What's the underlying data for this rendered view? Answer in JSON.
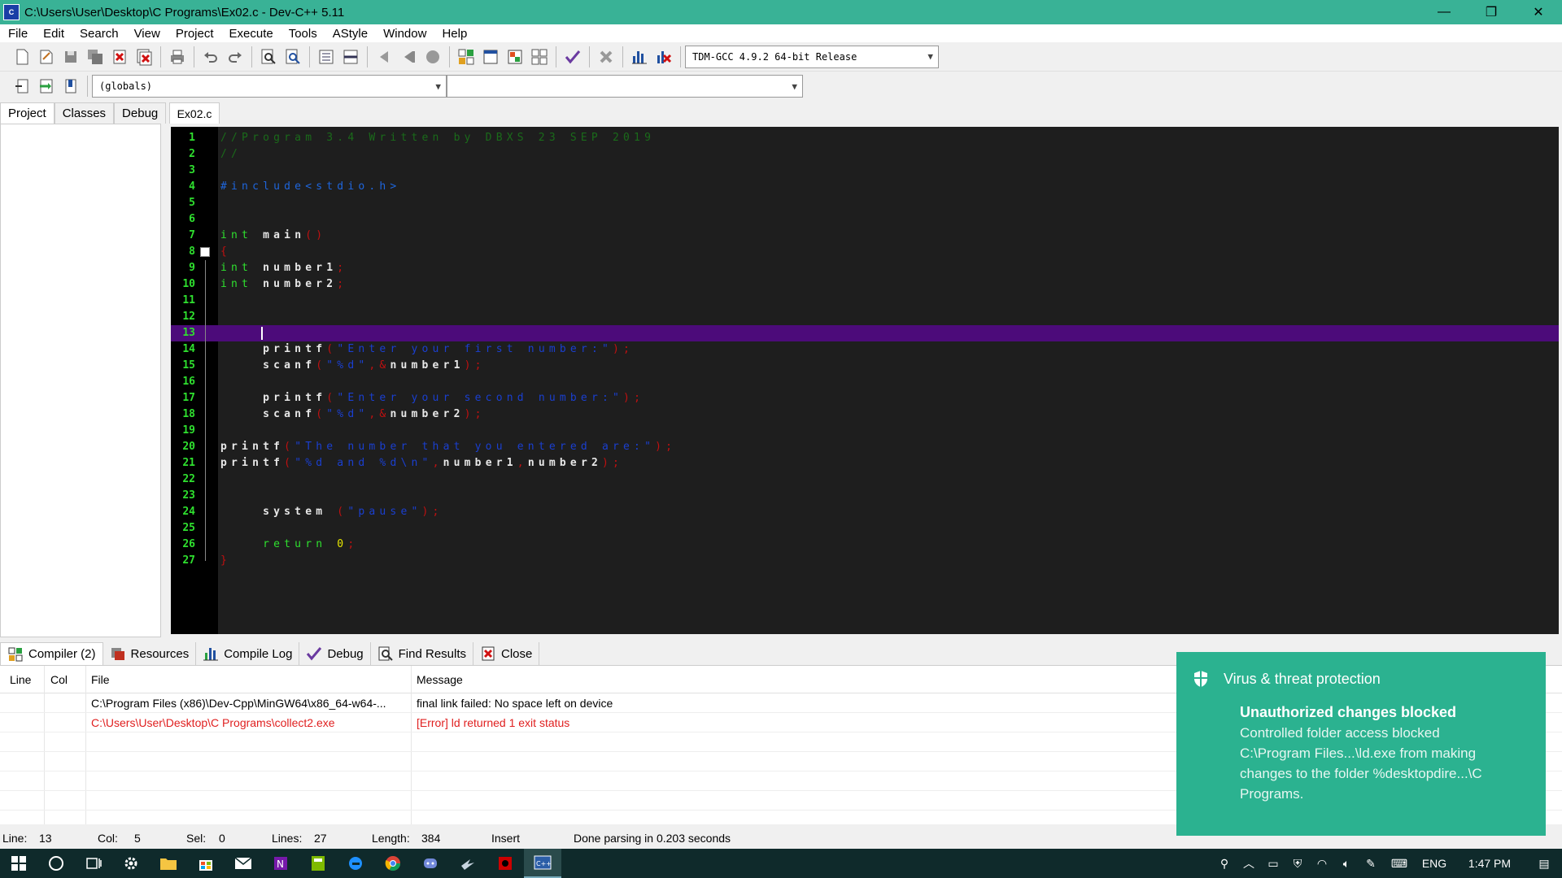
{
  "window": {
    "title": "C:\\Users\\User\\Desktop\\C Programs\\Ex02.c - Dev-C++ 5.11",
    "controls": [
      "—",
      "❐",
      "✕"
    ]
  },
  "menu": [
    "File",
    "Edit",
    "Search",
    "View",
    "Project",
    "Execute",
    "Tools",
    "AStyle",
    "Window",
    "Help"
  ],
  "toolbar": {
    "compiler": "TDM-GCC 4.9.2 64-bit Release",
    "scope": "(globals)",
    "member": ""
  },
  "left_tabs": [
    "Project",
    "Classes",
    "Debug"
  ],
  "editor": {
    "file_tab": "Ex02.c",
    "current_line": 13,
    "lines": [
      {
        "n": "1",
        "tokens": [
          {
            "t": "//Program 3.4 Written by DBXS 23 SEP 2019",
            "c": "com"
          }
        ]
      },
      {
        "n": "2",
        "tokens": [
          {
            "t": "//",
            "c": "com"
          }
        ]
      },
      {
        "n": "3",
        "tokens": []
      },
      {
        "n": "4",
        "tokens": [
          {
            "t": "#include<stdio.h>",
            "c": "pre"
          }
        ]
      },
      {
        "n": "5",
        "tokens": []
      },
      {
        "n": "6",
        "tokens": []
      },
      {
        "n": "7",
        "tokens": [
          {
            "t": "int ",
            "c": "kw"
          },
          {
            "t": "main",
            "c": "id"
          },
          {
            "t": "()",
            "c": "sym"
          }
        ]
      },
      {
        "n": "8",
        "tokens": [
          {
            "t": "{",
            "c": "sym"
          }
        ]
      },
      {
        "n": "9",
        "tokens": [
          {
            "t": "int ",
            "c": "kw"
          },
          {
            "t": "number1",
            "c": "id"
          },
          {
            "t": ";",
            "c": "sym"
          }
        ]
      },
      {
        "n": "10",
        "tokens": [
          {
            "t": "int ",
            "c": "kw"
          },
          {
            "t": "number2",
            "c": "id"
          },
          {
            "t": ";",
            "c": "sym"
          }
        ]
      },
      {
        "n": "11",
        "tokens": []
      },
      {
        "n": "12",
        "tokens": []
      },
      {
        "n": "13",
        "tokens": []
      },
      {
        "n": "14",
        "tokens": [
          {
            "t": "    printf",
            "c": "id"
          },
          {
            "t": "(",
            "c": "sym"
          },
          {
            "t": "\"Enter your first number:\"",
            "c": "str"
          },
          {
            "t": ");",
            "c": "sym"
          }
        ]
      },
      {
        "n": "15",
        "tokens": [
          {
            "t": "    scanf",
            "c": "id"
          },
          {
            "t": "(",
            "c": "sym"
          },
          {
            "t": "\"%d\"",
            "c": "str"
          },
          {
            "t": ",",
            "c": "sym"
          },
          {
            "t": "&",
            "c": "sym"
          },
          {
            "t": "number1",
            "c": "id"
          },
          {
            "t": ");",
            "c": "sym"
          }
        ]
      },
      {
        "n": "16",
        "tokens": []
      },
      {
        "n": "17",
        "tokens": [
          {
            "t": "    printf",
            "c": "id"
          },
          {
            "t": "(",
            "c": "sym"
          },
          {
            "t": "\"Enter your second number:\"",
            "c": "str"
          },
          {
            "t": ");",
            "c": "sym"
          }
        ]
      },
      {
        "n": "18",
        "tokens": [
          {
            "t": "    scanf",
            "c": "id"
          },
          {
            "t": "(",
            "c": "sym"
          },
          {
            "t": "\"%d\"",
            "c": "str"
          },
          {
            "t": ",",
            "c": "sym"
          },
          {
            "t": "&",
            "c": "sym"
          },
          {
            "t": "number2",
            "c": "id"
          },
          {
            "t": ");",
            "c": "sym"
          }
        ]
      },
      {
        "n": "19",
        "tokens": []
      },
      {
        "n": "20",
        "tokens": [
          {
            "t": "printf",
            "c": "id"
          },
          {
            "t": "(",
            "c": "sym"
          },
          {
            "t": "\"The number that you entered are:\"",
            "c": "str"
          },
          {
            "t": ");",
            "c": "sym"
          }
        ]
      },
      {
        "n": "21",
        "tokens": [
          {
            "t": "printf",
            "c": "id"
          },
          {
            "t": "(",
            "c": "sym"
          },
          {
            "t": "\"%d and %d\\n\"",
            "c": "str"
          },
          {
            "t": ",",
            "c": "sym"
          },
          {
            "t": "number1",
            "c": "id"
          },
          {
            "t": ",",
            "c": "sym"
          },
          {
            "t": "number2",
            "c": "id"
          },
          {
            "t": ");",
            "c": "sym"
          }
        ]
      },
      {
        "n": "22",
        "tokens": []
      },
      {
        "n": "23",
        "tokens": []
      },
      {
        "n": "24",
        "tokens": [
          {
            "t": "    system ",
            "c": "id"
          },
          {
            "t": "(",
            "c": "sym"
          },
          {
            "t": "\"pause\"",
            "c": "str"
          },
          {
            "t": ");",
            "c": "sym"
          }
        ]
      },
      {
        "n": "25",
        "tokens": []
      },
      {
        "n": "26",
        "tokens": [
          {
            "t": "    return ",
            "c": "kw"
          },
          {
            "t": "0",
            "c": "num"
          },
          {
            "t": ";",
            "c": "sym"
          }
        ]
      },
      {
        "n": "27",
        "tokens": [
          {
            "t": "}",
            "c": "sym"
          }
        ]
      }
    ]
  },
  "bottom_tabs": [
    "Compiler (2)",
    "Resources",
    "Compile Log",
    "Debug",
    "Find Results",
    "Close"
  ],
  "messages": {
    "headers": {
      "line": "Line",
      "col": "Col",
      "file": "File",
      "message": "Message"
    },
    "rows": [
      {
        "line": "",
        "col": "",
        "file": "C:\\Program Files (x86)\\Dev-Cpp\\MinGW64\\x86_64-w64-...",
        "message": "final link failed: No space left on device",
        "error": false
      },
      {
        "line": "",
        "col": "",
        "file": "C:\\Users\\User\\Desktop\\C Programs\\collect2.exe",
        "message": "[Error] ld returned 1 exit status",
        "error": true
      }
    ]
  },
  "status": {
    "line_label": "Line:",
    "line": "13",
    "col_label": "Col:",
    "col": "5",
    "sel_label": "Sel:",
    "sel": "0",
    "lines_label": "Lines:",
    "lines": "27",
    "length_label": "Length:",
    "length": "384",
    "mode": "Insert",
    "message": "Done parsing in 0.203 seconds"
  },
  "toast": {
    "app": "Virus & threat protection",
    "title": "Unauthorized changes blocked",
    "body": "Controlled folder access blocked C:\\Program Files...\\ld.exe from making changes to the folder %desktopdire...\\C Programs."
  },
  "tray": {
    "lang": "ENG",
    "time": "1:47 PM"
  },
  "colors": {
    "titlebar": "#39b296",
    "editor_bg": "#1e1e1e",
    "current_line": "#4c0b7a",
    "toast_bg": "#2bb290",
    "error": "#e02020"
  }
}
